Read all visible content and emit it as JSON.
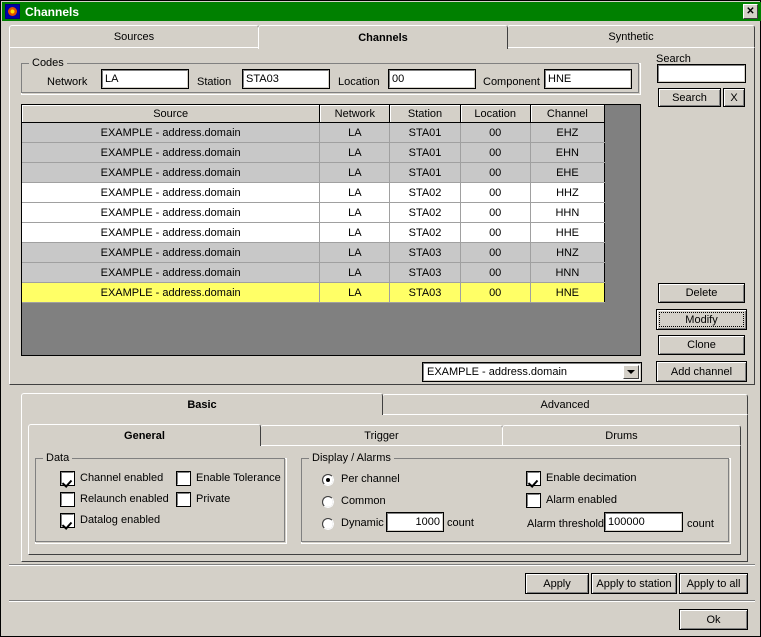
{
  "window": {
    "title": "Channels",
    "icon": "app-icon",
    "close_label": "✕"
  },
  "top_tabs": [
    {
      "label": "Sources",
      "selected": false
    },
    {
      "label": "Channels",
      "selected": true
    },
    {
      "label": "Synthetic",
      "selected": false
    }
  ],
  "codes": {
    "group_title": "Codes",
    "network_label": "Network",
    "network_value": "LA",
    "station_label": "Station",
    "station_value": "STA03",
    "location_label": "Location",
    "location_value": "00",
    "component_label": "Component",
    "component_value": "HNE"
  },
  "search": {
    "group_label": "Search",
    "value": "",
    "placeholder": "",
    "search_button": "Search",
    "clear_button": "X"
  },
  "table": {
    "columns": [
      "Source",
      "Network",
      "Station",
      "Location",
      "Channel"
    ],
    "rows": [
      {
        "source": "EXAMPLE - address.domain",
        "network": "LA",
        "station": "STA01",
        "location": "00",
        "channel": "EHZ",
        "state": "odd"
      },
      {
        "source": "EXAMPLE - address.domain",
        "network": "LA",
        "station": "STA01",
        "location": "00",
        "channel": "EHN",
        "state": "odd"
      },
      {
        "source": "EXAMPLE - address.domain",
        "network": "LA",
        "station": "STA01",
        "location": "00",
        "channel": "EHE",
        "state": "odd"
      },
      {
        "source": "EXAMPLE - address.domain",
        "network": "LA",
        "station": "STA02",
        "location": "00",
        "channel": "HHZ",
        "state": "even"
      },
      {
        "source": "EXAMPLE - address.domain",
        "network": "LA",
        "station": "STA02",
        "location": "00",
        "channel": "HHN",
        "state": "even"
      },
      {
        "source": "EXAMPLE - address.domain",
        "network": "LA",
        "station": "STA02",
        "location": "00",
        "channel": "HHE",
        "state": "even"
      },
      {
        "source": "EXAMPLE - address.domain",
        "network": "LA",
        "station": "STA03",
        "location": "00",
        "channel": "HNZ",
        "state": "odd"
      },
      {
        "source": "EXAMPLE - address.domain",
        "network": "LA",
        "station": "STA03",
        "location": "00",
        "channel": "HNN",
        "state": "odd"
      },
      {
        "source": "EXAMPLE - address.domain",
        "network": "LA",
        "station": "STA03",
        "location": "00",
        "channel": "HNE",
        "state": "selr"
      }
    ],
    "selected_row_color": "#ffff66",
    "background_color": "#808080"
  },
  "source_combo": {
    "value": "EXAMPLE - address.domain"
  },
  "side_buttons": {
    "delete": "Delete",
    "modify": "Modify",
    "clone": "Clone",
    "add_channel": "Add channel"
  },
  "lower_tabs": [
    {
      "label": "Basic",
      "selected": true
    },
    {
      "label": "Advanced",
      "selected": false
    }
  ],
  "inner_tabs": [
    {
      "label": "General",
      "selected": true
    },
    {
      "label": "Trigger",
      "selected": false
    },
    {
      "label": "Drums",
      "selected": false
    }
  ],
  "data_group": {
    "title": "Data",
    "channel_enabled": {
      "label": "Channel enabled",
      "checked": true
    },
    "relaunch_enabled": {
      "label": "Relaunch enabled",
      "checked": false
    },
    "datalog_enabled": {
      "label": "Datalog enabled",
      "checked": true
    },
    "enable_tolerance": {
      "label": "Enable Tolerance",
      "checked": false
    },
    "private": {
      "label": "Private",
      "checked": false
    }
  },
  "display_group": {
    "title": "Display / Alarms",
    "per_channel": {
      "label": "Per channel",
      "selected": true
    },
    "common": {
      "label": "Common",
      "selected": false
    },
    "dynamic": {
      "label": "Dynamic",
      "selected": false
    },
    "dynamic_value": "1000",
    "dynamic_unit": "count",
    "enable_decimation": {
      "label": "Enable decimation",
      "checked": true
    },
    "alarm_enabled": {
      "label": "Alarm enabled",
      "checked": false
    },
    "alarm_threshold_label": "Alarm threshold",
    "alarm_threshold_value": "100000",
    "alarm_threshold_unit": "count"
  },
  "footer": {
    "apply": "Apply",
    "apply_to_station": "Apply to station",
    "apply_to_all": "Apply to all",
    "ok": "Ok"
  }
}
